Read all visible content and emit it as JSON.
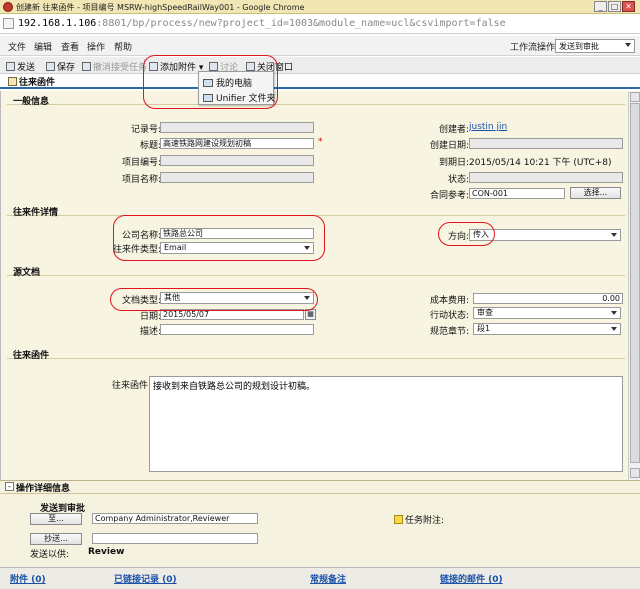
{
  "window": {
    "title": "创建新 往来函件 - 项目编号 MSRW-highSpeedRailWay001 - Google Chrome",
    "url_host": "192.168.1.106",
    "url_rest": ":8801/bp/process/new?project_id=1003&module_name=ucl&csvimport=false"
  },
  "menu": {
    "items": [
      "文件",
      "编辑",
      "查看",
      "操作",
      "帮助"
    ],
    "workflow_label": "工作流操作",
    "workflow_value": "发送到审批"
  },
  "toolbar": {
    "send": "发送",
    "save": "保存",
    "cancel_task": "撤消接受任务",
    "add_attachment": "添加附件",
    "discuss": "讨论",
    "close_window": "关闭窗口"
  },
  "tab": {
    "title": "往来函件"
  },
  "popup": {
    "items": [
      "我的电脑",
      "Unifier 文件夹"
    ]
  },
  "general": {
    "header": "一般信息",
    "record_no_label": "记录号:",
    "title_label": "标题:",
    "title_value": "高速铁路网建设规划初稿",
    "project_no_label": "项目编号:",
    "project_name_label": "项目名称:",
    "creator_label": "创建者:",
    "creator_value": "justin jin",
    "create_date_label": "创建日期:",
    "due_date_label": "到期日:",
    "due_date_value": "2015/05/14 10:21 下午 (UTC+8)",
    "status_label": "状态:",
    "contract_label": "合同参考:",
    "contract_value": "CON-001",
    "select_button": "选择..."
  },
  "detail": {
    "header": "往来件详情",
    "company_label": "公司名称:",
    "company_value": "铁路总公司",
    "type_label": "往来件类型:",
    "type_value": "Email",
    "direction_label": "方向:",
    "direction_value": "传入"
  },
  "source": {
    "header": "源文档",
    "doctype_label": "文档类型:",
    "doctype_value": "其他",
    "date_label": "日期:",
    "date_value": "2015/05/07",
    "desc_label": "描述:",
    "cost_label": "成本费用:",
    "cost_value": "0.00",
    "action_label": "行动状态:",
    "action_value": "审查",
    "spec_label": "规范章节:",
    "spec_value": "段1"
  },
  "letter": {
    "header": "往来函件",
    "label": "往来函件:",
    "value": "接收到来自铁路总公司的规划设计初稿。"
  },
  "ops": {
    "header": "操作详细信息",
    "send_title": "发送到审批",
    "to_button": "至...",
    "to_value": "Company Administrator,Reviewer",
    "cc_button": "抄送...",
    "cc_value": "",
    "sent_for_label": "发送以供:",
    "sent_for_value": "Review",
    "task_note_label": "任务附注:"
  },
  "bottom": {
    "attachments": "附件 (0)",
    "linked_records": "已链接记录 (0)",
    "general_notes": "常规备注",
    "linked_mail": "链接的邮件 (0)"
  }
}
